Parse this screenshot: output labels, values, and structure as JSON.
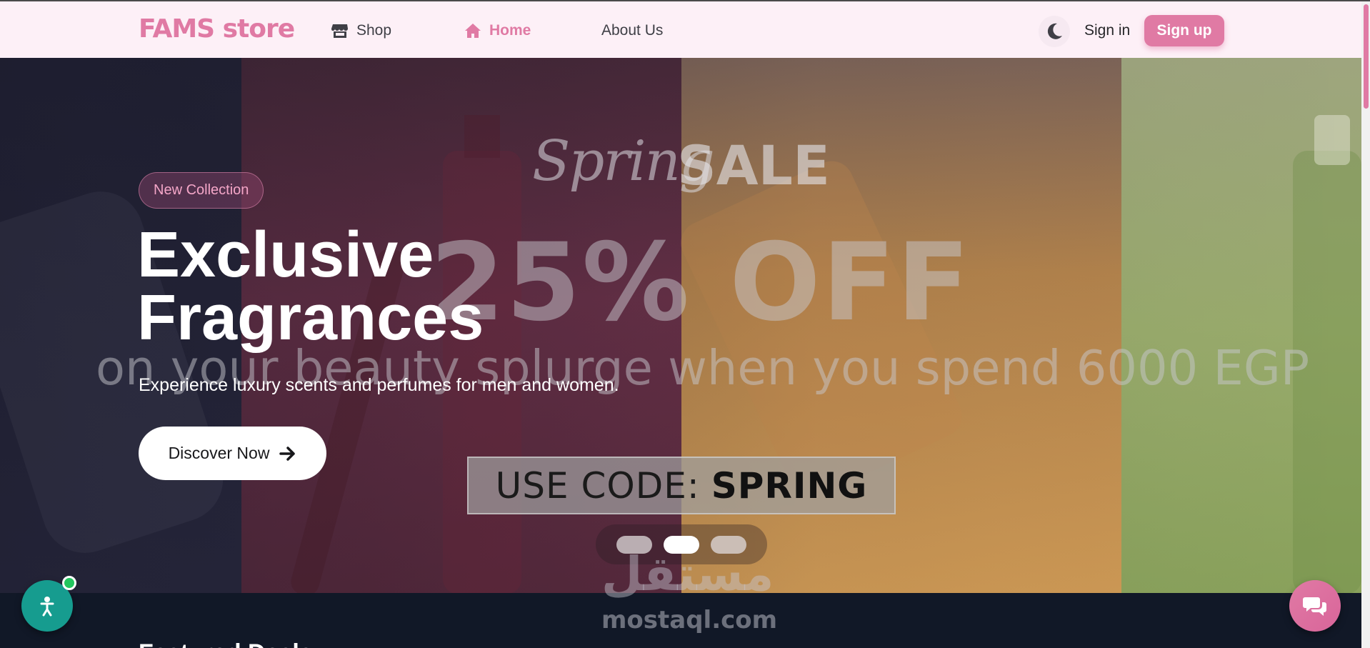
{
  "nav": {
    "logo": "FAMS store",
    "links": [
      {
        "label": "Shop",
        "icon": "store-icon"
      },
      {
        "label": "Home",
        "icon": "home-icon",
        "active": true
      },
      {
        "label": "About Us"
      }
    ],
    "theme_toggle_icon": "moon-icon",
    "signin_label": "Sign in",
    "signup_label": "Sign up"
  },
  "hero": {
    "badge": "New Collection",
    "title_line1": "Exclusive",
    "title_line2": "Fragrances",
    "subtitle": "Experience luxury scents and perfumes for men and women.",
    "cta_label": "Discover Now",
    "cta_icon": "arrow-right-icon",
    "banner": {
      "spring": "Spring",
      "sale": "SALE",
      "discount": "25% OFF",
      "tagline": "on your beauty splurge when you spend 6000 EGP",
      "code_label": "USE CODE:",
      "code_value": "SPRING"
    },
    "carousel": {
      "slides": 3,
      "active_index": 1
    }
  },
  "section": {
    "title": "Featured Deals"
  },
  "watermark": {
    "arabic": "مستقل",
    "text": "mostaql.com"
  },
  "floating": {
    "accessibility_icon": "accessibility-icon",
    "chat_icon": "chat-icon"
  },
  "colors": {
    "brand": "#e07aa4",
    "nav_bg": "#fdf0f7",
    "dark_bg": "#111827",
    "teal": "#169c8f",
    "online": "#22c55e"
  }
}
